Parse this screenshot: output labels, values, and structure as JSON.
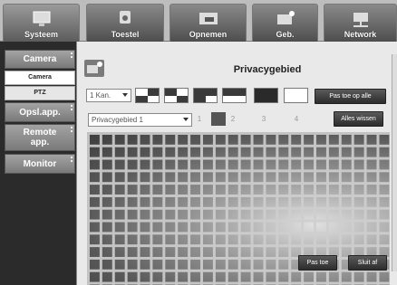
{
  "top_tabs": [
    {
      "label": "Systeem",
      "icon": "monitor-icon"
    },
    {
      "label": "Toestel",
      "icon": "camera-device-icon"
    },
    {
      "label": "Opnemen",
      "icon": "rec-icon"
    },
    {
      "label": "Geb.",
      "icon": "event-icon"
    },
    {
      "label": "Network",
      "icon": "network-icon"
    }
  ],
  "sidebar": {
    "camera": "Camera",
    "camera_sub": "Camera",
    "ptz_sub": "PTZ",
    "opsl": "Opsl.app.",
    "remote": "Remote app.",
    "monitor": "Monitor"
  },
  "main": {
    "title": "Privacygebied",
    "channel_select": "1 Kan.",
    "apply_all_button": "Pas toe op alle",
    "area_select": "Privacygebied 1",
    "area_numbers": [
      "1",
      "2",
      "3",
      "4"
    ],
    "clear_all_button": "Alles wissen",
    "apply_button": "Pas toe",
    "close_button": "Sluit af"
  },
  "colors": {
    "active_tab": "#6e6e6e",
    "sidebar_bg": "#2b2b2b",
    "button_dark": "#3a3a3a"
  }
}
